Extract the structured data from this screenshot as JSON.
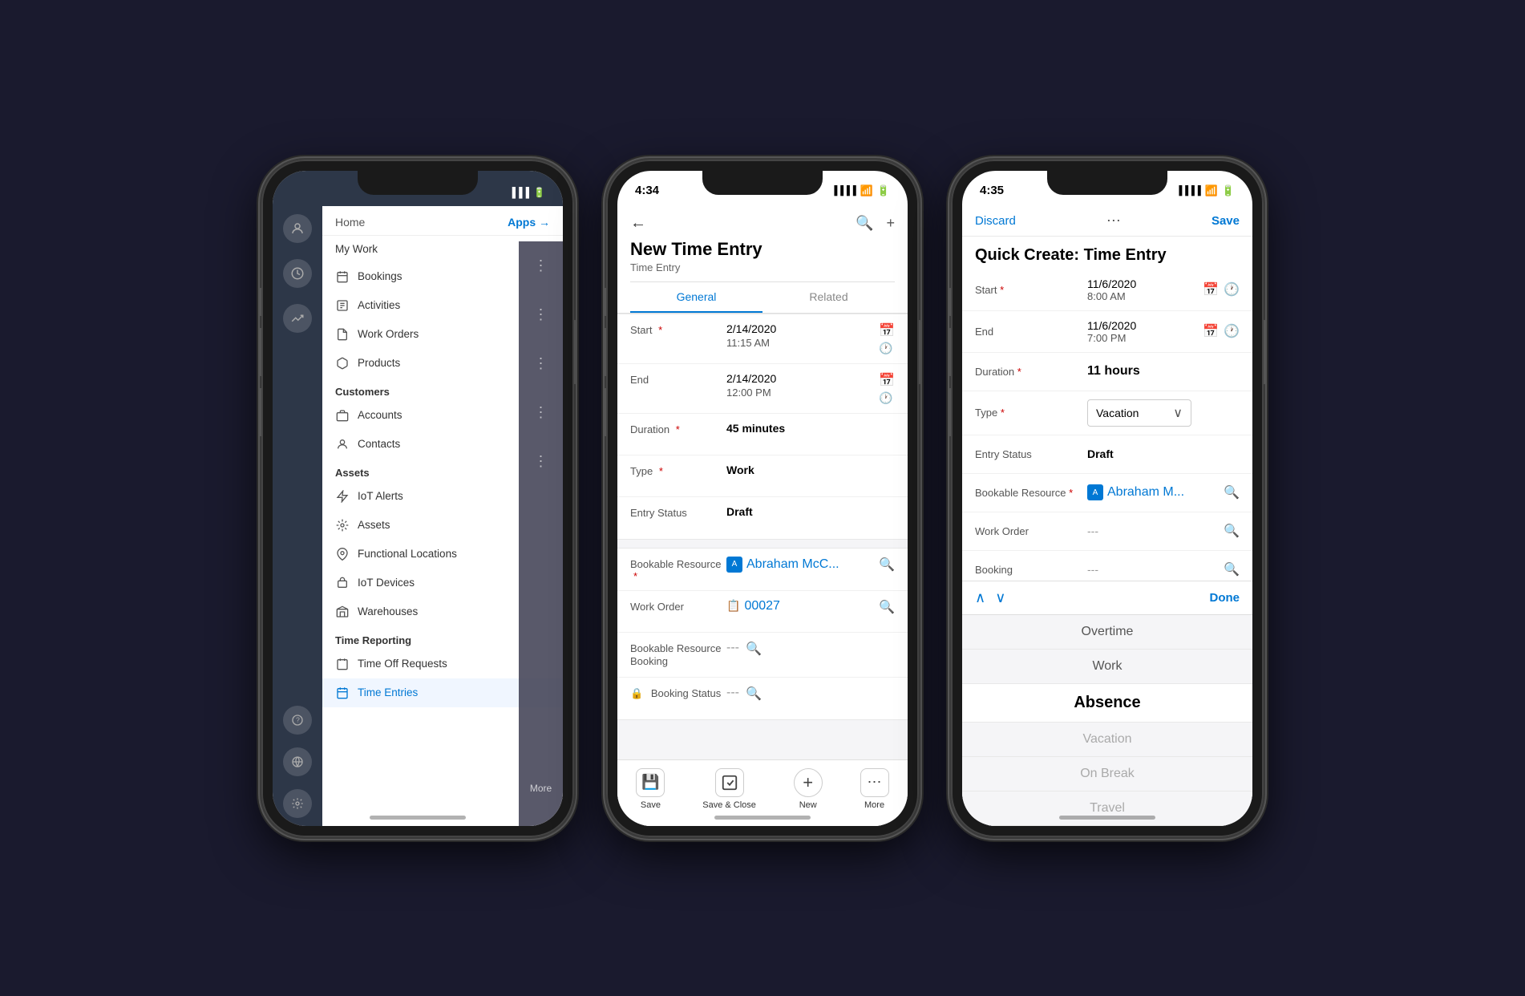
{
  "scene": {
    "background": "#1a1a2e"
  },
  "phone1": {
    "status": {
      "time": "",
      "battery": "🔋",
      "wifi": "📶"
    },
    "nav": {
      "home_label": "Home",
      "apps_label": "Apps →",
      "my_work_label": "My Work",
      "bookings_label": "Bookings",
      "activities_label": "Activities",
      "work_orders_label": "Work Orders",
      "products_label": "Products",
      "customers_section": "Customers",
      "accounts_label": "Accounts",
      "contacts_label": "Contacts",
      "assets_section": "Assets",
      "iot_alerts_label": "IoT Alerts",
      "assets_label": "Assets",
      "functional_locations_label": "Functional Locations",
      "iot_devices_label": "IoT Devices",
      "warehouses_label": "Warehouses",
      "time_reporting_section": "Time Reporting",
      "time_off_requests_label": "Time Off Requests",
      "time_entries_label": "Time Entries",
      "more_label": "More"
    }
  },
  "phone2": {
    "status": {
      "time": "4:34"
    },
    "form": {
      "title": "New Time Entry",
      "subtitle": "Time Entry",
      "tab_general": "General",
      "tab_related": "Related",
      "back_icon": "←",
      "search_icon": "🔍",
      "plus_icon": "+",
      "start_label": "Start",
      "start_date": "2/14/2020",
      "start_time": "11:15 AM",
      "end_label": "End",
      "end_date": "2/14/2020",
      "end_time": "12:00 PM",
      "duration_label": "Duration",
      "duration_value": "45 minutes",
      "type_label": "Type",
      "type_value": "Work",
      "entry_status_label": "Entry Status",
      "entry_status_value": "Draft",
      "bookable_resource_label": "Bookable Resource",
      "bookable_resource_value": "Abraham McC...",
      "work_order_label": "Work Order",
      "work_order_value": "00027",
      "booking_label": "Bookable Resource\nBooking",
      "booking_value": "---",
      "booking_status_label": "Booking Status",
      "booking_status_value": "---",
      "save_label": "Save",
      "save_close_label": "Save & Close",
      "new_label": "New",
      "more_label": "More"
    }
  },
  "phone3": {
    "status": {
      "time": "4:35"
    },
    "form": {
      "title": "Quick Create: Time Entry",
      "discard_label": "Discard",
      "save_label": "Save",
      "start_label": "Start",
      "start_date": "11/6/2020",
      "start_time": "8:00 AM",
      "end_label": "End",
      "end_date": "11/6/2020",
      "end_time": "7:00 PM",
      "duration_label": "Duration",
      "duration_value": "11 hours",
      "type_label": "Type",
      "type_value": "Vacation",
      "entry_status_label": "Entry Status",
      "entry_status_value": "Draft",
      "bookable_resource_label": "Bookable Resource",
      "bookable_resource_value": "Abraham M...",
      "work_order_label": "Work Order",
      "work_order_value": "---",
      "booking_label": "Booking",
      "booking_value": "---",
      "done_label": "Done",
      "picker_items": [
        {
          "label": "Overtime",
          "state": "normal"
        },
        {
          "label": "Work",
          "state": "normal"
        },
        {
          "label": "Absence",
          "state": "selected"
        },
        {
          "label": "Vacation",
          "state": "dimmed"
        },
        {
          "label": "On Break",
          "state": "dimmed"
        },
        {
          "label": "Travel",
          "state": "dimmed"
        }
      ]
    }
  }
}
